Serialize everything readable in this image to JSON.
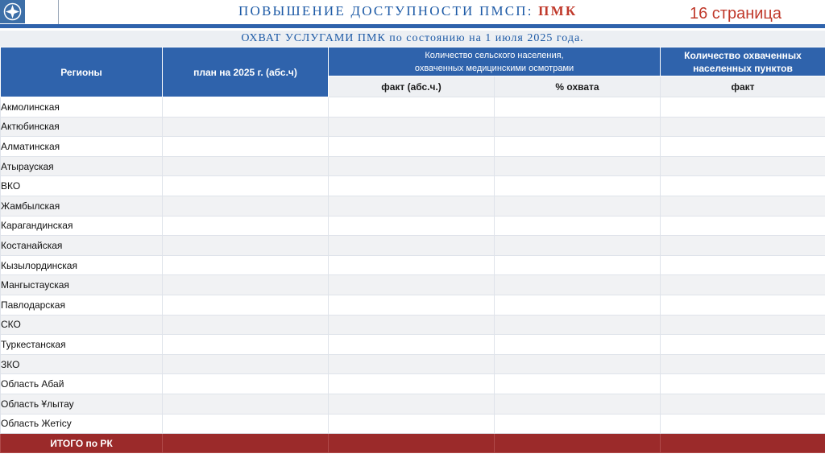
{
  "header": {
    "title_main": "ПОВЫШЕНИЕ ДОСТУПНОСТИ ПМСП:",
    "title_accent": "ПМК",
    "page_label": "16 страница"
  },
  "subtitle": "ОХВАТ УСЛУГАМИ ПМК по состоянию на 1 июля 2025 года.",
  "colors": {
    "header_blue": "#2f63ac",
    "title_blue": "#1d5aa6",
    "accent_red": "#c0392b",
    "total_row": "#9b2a2a"
  },
  "table": {
    "headers": {
      "regions": "Регионы",
      "plan": "план на 2025 г. (абс.ч)",
      "rural_line1": "Количество сельского населения,",
      "rural_line2": "охваченных медицинскими осмотрами",
      "settlements_line1": "Количество охваченных",
      "settlements_line2": "населенных пунктов",
      "fact": "факт (абс.ч.)",
      "coverage": "% охвата",
      "fact_settlements": "факт"
    },
    "rows": [
      "Акмолинская",
      "Актюбинская",
      "Алматинская",
      "Атырауская",
      "ВКО",
      "Жамбылская",
      "Карагандинская",
      "Костанайская",
      "Кызылординская",
      "Мангыстауская",
      "Павлодарская",
      "СКО",
      "Туркестанская",
      "ЗКО",
      "Область Абай",
      "Область Ұлытау",
      "Область Жетісу"
    ],
    "total_label": "ИТОГО по РК"
  }
}
